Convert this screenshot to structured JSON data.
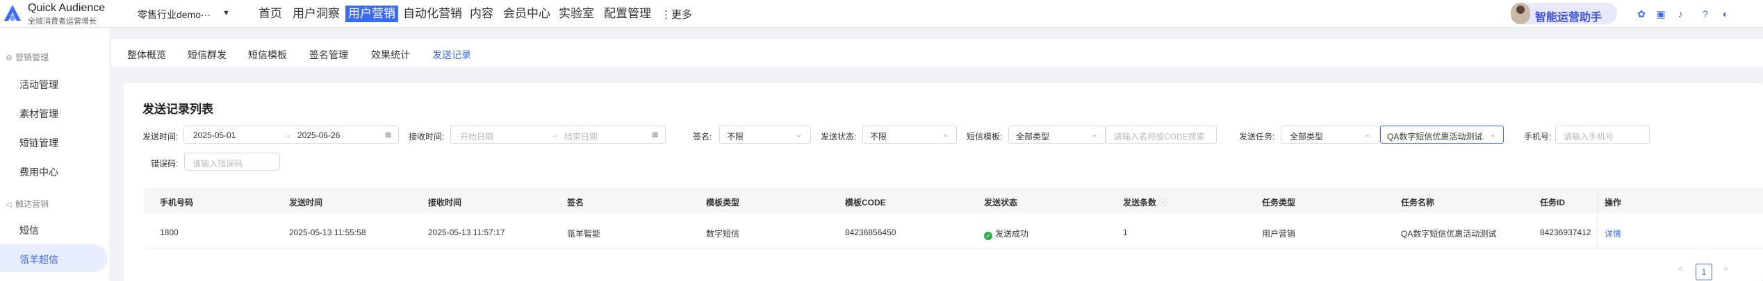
{
  "brand": {
    "title": "Quick Audience",
    "subtitle": "全域消费者运营增长"
  },
  "industry": {
    "label": "零售行业demo···",
    "caret": "▼"
  },
  "nav": [
    {
      "label": "首页"
    },
    {
      "label": "用户洞察"
    },
    {
      "label": "用户营销",
      "active": true
    },
    {
      "label": "自动化营销"
    },
    {
      "label": "内容"
    },
    {
      "label": "会员中心"
    },
    {
      "label": "实验室"
    },
    {
      "label": "配置管理"
    }
  ],
  "more_label": "⋮更多",
  "assistant_label": "智能运营助手",
  "toolbar_icons": [
    "settings-icon",
    "briefcase-icon",
    "bell-icon",
    "help-icon",
    "theme-icon"
  ],
  "sidebar": {
    "groups": [
      {
        "label": "营销管理",
        "icon": "gear-icon",
        "items": [
          "活动管理",
          "素材管理",
          "短链管理",
          "费用中心"
        ]
      },
      {
        "label": "触达营销",
        "icon": "send-icon",
        "items": [
          "短信",
          "瓴羊超信"
        ]
      }
    ],
    "active_item": "瓴羊超信"
  },
  "tabs": [
    "整体概览",
    "短信群发",
    "短信模板",
    "签名管理",
    "效果统计",
    "发送记录"
  ],
  "active_tab": "发送记录",
  "card_title": "发送记录列表",
  "filters": {
    "send_time_label": "发送时间:",
    "send_time_start": "2025-05-01",
    "send_time_end": "2025-06-26",
    "range_arrow": "→",
    "recv_time_label": "接收时间:",
    "recv_start_ph": "开始日期",
    "recv_end_ph": "结束日期",
    "sign_label": "签名:",
    "sign_value": "不限",
    "status_label": "发送状态:",
    "status_value": "不限",
    "template_label": "短信模板:",
    "template_type": "全部类型",
    "template_search_ph": "请输入名称或CODE搜索",
    "task_label": "发送任务:",
    "task_type": "全部类型",
    "task_value": "QA数字短信优惠活动测试",
    "phone_label": "手机号:",
    "phone_ph": "请输入手机号",
    "errcode_label": "错误码:",
    "errcode_ph": "请输入错误码"
  },
  "table": {
    "columns": [
      "手机号码",
      "发送时间",
      "接收时间",
      "签名",
      "模板类型",
      "模板CODE",
      "发送状态",
      "发送条数",
      "任务类型",
      "任务名称",
      "任务ID",
      "操作"
    ],
    "rows": [
      {
        "phone": "1800",
        "send_time": "2025-05-13 11:55:58",
        "recv_time": "2025-05-13 11:57:17",
        "sign": "瓴羊智能",
        "template_type": "数字短信",
        "template_code": "84236856450",
        "status": "发送成功",
        "count": "1",
        "task_type": "用户营销",
        "task_name": "QA数字短信优惠活动测试",
        "task_id": "84236937412",
        "action": "详情"
      }
    ]
  },
  "pagination": {
    "prev": "<",
    "current": "1",
    "next": ">"
  },
  "colors": {
    "accent": "#3b6cf6",
    "success": "#2bb24c"
  }
}
